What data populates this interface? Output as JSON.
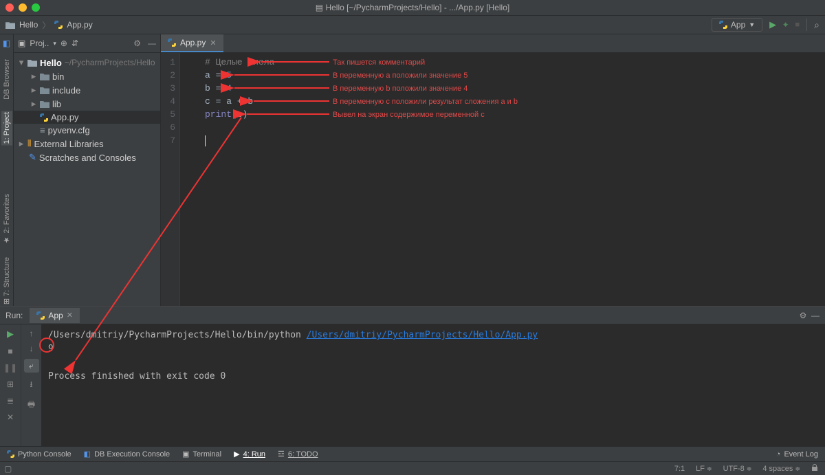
{
  "window_title": "Hello [~/PycharmProjects/Hello] - .../App.py [Hello]",
  "breadcrumb": {
    "project": "Hello",
    "file": "App.py"
  },
  "run_config": {
    "label": "App"
  },
  "left_tools": {
    "dbBrowser": "DB Browser",
    "project": "1: Project",
    "favorites": "2: Favorites",
    "structure": "7: Structure"
  },
  "project_panel": {
    "title": "Proj..",
    "root": {
      "name": "Hello",
      "path": "~/PycharmProjects/Hello"
    },
    "children": [
      "bin",
      "include",
      "lib"
    ],
    "files": [
      "App.py",
      "pyvenv.cfg"
    ],
    "extLib": "External Libraries",
    "scratches": "Scratches and Consoles"
  },
  "editor": {
    "tab": "App.py",
    "lines": {
      "l1_comment": "# Целые числа",
      "l2_a": "a",
      "l2_eq": " = ",
      "l2_v": "5",
      "l3_b": "b",
      "l3_eq": " = ",
      "l3_v": "4",
      "l4_c": "c",
      "l4_eq": " = ",
      "l4_rhs": "a + b",
      "l5_fn": "print",
      "l5_arg": "c"
    }
  },
  "annotations": {
    "a1": "Так пишется комментарий",
    "a2": "В переменную a положили значение 5",
    "a3": "В переменную b положили значение 4",
    "a4": "В переменную c положили результат сложения a и b",
    "a5": "Вывел на экран содержимое переменной c"
  },
  "run_panel": {
    "title": "Run:",
    "tab": "App",
    "cmd_prefix": "/Users/dmitriy/PycharmProjects/Hello/bin/python ",
    "cmd_link": "/Users/dmitriy/PycharmProjects/Hello/App.py",
    "output": "9",
    "exit": "Process finished with exit code 0"
  },
  "bottom_tools": {
    "pyconsole": "Python Console",
    "dbexec": "DB Execution Console",
    "terminal": "Terminal",
    "run": "4: Run",
    "todo": "6: TODO",
    "eventlog": "Event Log"
  },
  "statusbar": {
    "pos": "7:1",
    "lf": "LF",
    "enc": "UTF-8",
    "indent": "4 spaces"
  }
}
